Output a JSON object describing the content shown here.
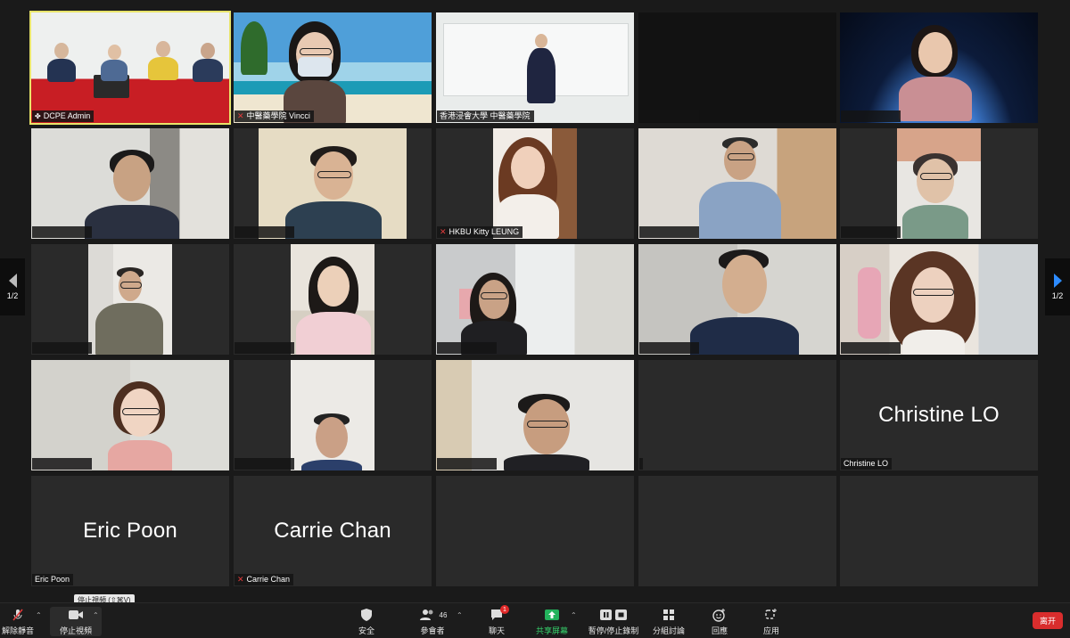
{
  "pager": {
    "left_label": "1/2",
    "right_label": "1/2"
  },
  "tiles": {
    "r1c1": {
      "name": "DCPE Admin"
    },
    "r1c2": {
      "name": "中醫藥學院 Vincci"
    },
    "r1c3": {
      "name": "香港浸會大學 中醫藥學院"
    },
    "r2c3": {
      "name": "HKBU Kitty LEUNG"
    },
    "r4c5": {
      "name": "Christine LO",
      "display_name": "Christine LO"
    },
    "r5c1": {
      "name": "Eric Poon",
      "display_name": "Eric Poon"
    },
    "r5c2": {
      "name": "Carrie Chan",
      "display_name": "Carrie Chan"
    }
  },
  "toolbar": {
    "unmute": "解除靜音",
    "stop_video": "停止視頻",
    "tooltip": "停止視頻 (⇧⌘V)",
    "security": "安全",
    "participants": "參會者",
    "participants_count": "46",
    "chat": "聊天",
    "chat_badge": "1",
    "share": "共享屏幕",
    "record": "暫停/停止錄制",
    "breakout": "分組討論",
    "reactions": "回應",
    "apps": "应用",
    "leave": "离开"
  }
}
